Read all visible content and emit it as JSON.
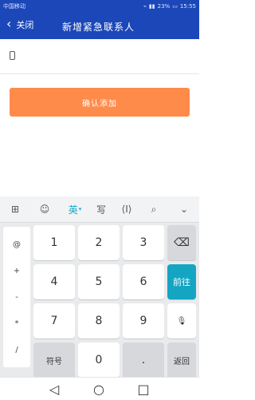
{
  "status": {
    "carrier": "中国移动",
    "battery": "23%",
    "time": "15:55"
  },
  "header": {
    "back_label": "关闭",
    "title": "新增紧急联系人"
  },
  "form": {
    "phone_value": "",
    "phone_placeholder": "",
    "confirm_label": "确认添加"
  },
  "keyboard": {
    "toolbar_items": [
      "grid-icon",
      "emoji-icon",
      "英",
      "写",
      "cursor-move-icon",
      "search-icon",
      "collapse-icon"
    ],
    "symbols": [
      "@",
      "+",
      "-",
      "*",
      "/"
    ],
    "keys": {
      "1": "1",
      "2": "2",
      "3": "3",
      "4": "4",
      "5": "5",
      "6": "6",
      "7": "7",
      "8": "8",
      "9": "9",
      "0": "0",
      "backspace": "⌫",
      "go": "前往",
      "mic": "🎙",
      "fuhao": "符号",
      "dot": ".",
      "return": "返回"
    }
  },
  "navbar": {
    "back_icon": "back-triangle-icon",
    "home_icon": "home-circle-icon",
    "recents_icon": "recents-square-icon"
  }
}
